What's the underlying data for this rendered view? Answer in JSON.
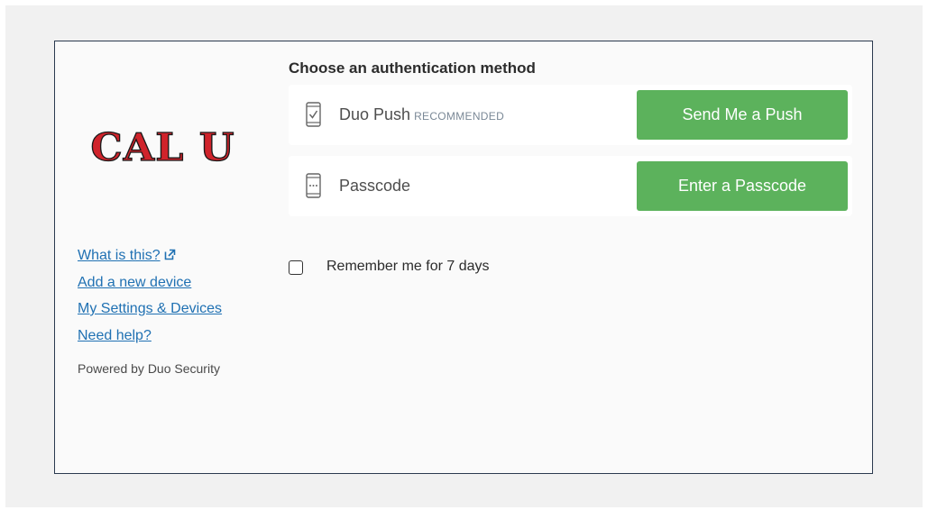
{
  "logo": {
    "text": "CAL U",
    "colors": {
      "fill": "#d0232b",
      "outline": "#1a1a1a"
    }
  },
  "sidebar": {
    "links": [
      {
        "label": "What is this?",
        "icon": "external-link-icon"
      },
      {
        "label": "Add a new device"
      },
      {
        "label": "My Settings & Devices"
      },
      {
        "label": "Need help?"
      }
    ],
    "powered_by": "Powered by Duo Security"
  },
  "main": {
    "heading": "Choose an authentication method",
    "methods": [
      {
        "label": "Duo Push",
        "badge": "RECOMMENDED",
        "icon": "phone-check-icon",
        "button": "Send Me a Push"
      },
      {
        "label": "Passcode",
        "icon": "phone-passcode-icon",
        "button": "Enter a Passcode"
      }
    ],
    "remember": {
      "label": "Remember me for 7 days",
      "checked": false
    }
  },
  "colors": {
    "button": "#5cb25c",
    "link": "#2071b3",
    "frame_border": "#2b3a4f"
  }
}
